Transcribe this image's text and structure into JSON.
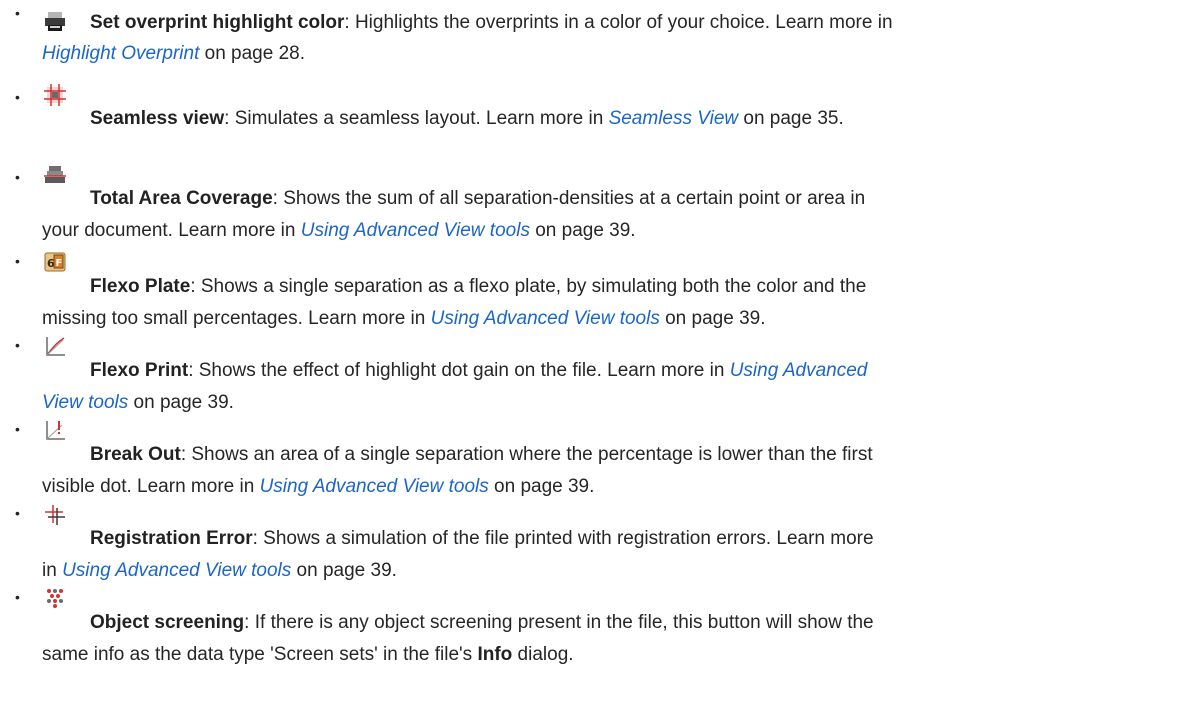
{
  "items": [
    {
      "icon": "printer-overprint-icon",
      "title": "Set overprint highlight color",
      "line1_text": ": Highlights the overprints in a color of your choice. Learn more in",
      "link": "Highlight Overprint",
      "line2_after": "  on page 28."
    },
    {
      "icon": "seamless-grid-icon",
      "title": "Seamless view",
      "line1_text": ": Simulates a seamless layout. Learn more in ",
      "link": "Seamless View",
      "line1_after": " on page 35."
    },
    {
      "icon": "total-area-coverage-icon",
      "title": "Total Area Coverage",
      "line1_text": ": Shows the sum of all separation-densities at a certain point or area in",
      "line2_text": "your document. Learn more in ",
      "link": "Using Advanced View tools",
      "line2_after": " on page 39."
    },
    {
      "icon": "flexo-plate-icon",
      "title": "Flexo Plate",
      "line1_text": ": Shows a single separation as a flexo plate, by simulating both the color and the",
      "line2_text": "missing too small percentages. Learn more in ",
      "link": "Using Advanced View tools",
      "line2_after": " on page 39."
    },
    {
      "icon": "flexo-print-curve-icon",
      "title": "Flexo Print",
      "line1_text": ": Shows the effect of highlight dot gain on the file. Learn more in ",
      "link_part1": "Using Advanced",
      "link_part2": "View tools",
      "line2_after": " on page 39."
    },
    {
      "icon": "break-out-icon",
      "title": "Break Out",
      "line1_text": ": Shows an area of a single separation where the percentage is lower than the first",
      "line2_text": "visible dot. Learn more in ",
      "link": "Using Advanced View tools",
      "line2_after": " on page 39."
    },
    {
      "icon": "registration-error-icon",
      "title": "Registration Error",
      "line1_text": ": Shows a simulation of the file printed with registration errors. Learn more",
      "line2_text": "in ",
      "link": "Using Advanced View tools",
      "line2_after": " on page 39."
    },
    {
      "icon": "object-screening-icon",
      "title": "Object screening",
      "line1_text": ": If there is any object screening present in the file, this button will show the",
      "line2_text": "same info as the data type 'Screen sets' in the file's ",
      "bold2": "Info",
      "line2_after": " dialog."
    }
  ],
  "bullet_char": "•",
  "colors": {
    "text": "#262626",
    "link": "#1a66c8"
  }
}
